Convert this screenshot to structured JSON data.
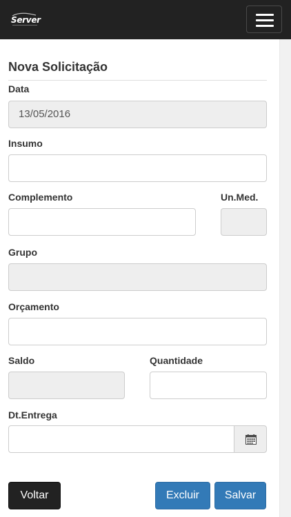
{
  "navbar": {
    "brand": "Server",
    "brand_logo_icon": "server-logo-icon",
    "menu_icon": "hamburger-menu-icon"
  },
  "form": {
    "title": "Nova Solicitação",
    "fields": {
      "data": {
        "label": "Data",
        "value": "13/05/2016",
        "disabled": true
      },
      "insumo": {
        "label": "Insumo",
        "value": ""
      },
      "complemento": {
        "label": "Complemento",
        "value": ""
      },
      "unmed": {
        "label": "Un.Med.",
        "value": "",
        "disabled": true
      },
      "grupo": {
        "label": "Grupo",
        "value": "",
        "disabled": true
      },
      "orcamento": {
        "label": "Orçamento",
        "value": ""
      },
      "saldo": {
        "label": "Saldo",
        "value": "",
        "disabled": true
      },
      "quantidade": {
        "label": "Quantidade",
        "value": ""
      },
      "dtentrega": {
        "label": "Dt.Entrega",
        "value": "",
        "addon_icon": "calendar-icon"
      }
    }
  },
  "actions": {
    "voltar": "Voltar",
    "excluir": "Excluir",
    "salvar": "Salvar"
  },
  "colors": {
    "navbar_bg": "#222222",
    "primary": "#337ab7",
    "dark_button": "#222222",
    "disabled_bg": "#eeeeee",
    "border": "#cccccc"
  }
}
